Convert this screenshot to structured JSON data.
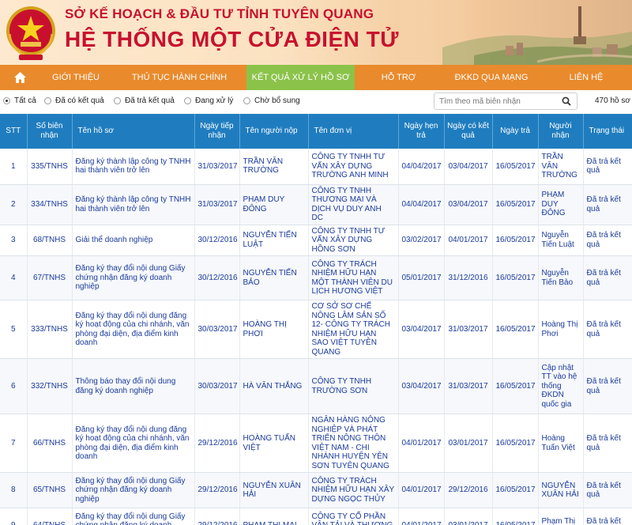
{
  "header": {
    "org_name": "SỞ KẾ HOẠCH & ĐẦU TƯ TỈNH TUYÊN QUANG",
    "system_name": "HỆ THỐNG MỘT CỬA ĐIỆN TỬ"
  },
  "nav": {
    "home_icon": "home-icon",
    "items": [
      "GIỚI THIỆU",
      "THỦ TỤC HÀNH CHÍNH",
      "KẾT QUẢ XỬ LÝ HỒ SƠ",
      "HỖ TRỢ",
      "ĐKKD QUA MẠNG",
      "LIÊN HỆ"
    ],
    "active_index": 2,
    "bar_color": "#e98a2c",
    "active_color": "#8bc34a"
  },
  "filters": {
    "options": [
      "Tất cả",
      "Đã có kết quả",
      "Đã trả kết quả",
      "Đang xử lý",
      "Chờ bổ sung"
    ],
    "selected_index": 0,
    "search_placeholder": "Tìm theo mã biên nhận",
    "search_icon": "search-icon",
    "total_text": "470 hồ sơ"
  },
  "table": {
    "headers": [
      "STT",
      "Số biên nhận",
      "Tên hồ sơ",
      "Ngày tiếp nhận",
      "Tên người nộp",
      "Tên đơn vị",
      "Ngày hẹn trả",
      "Ngày có kết quả",
      "Ngày trả",
      "Người nhận",
      "Trạng thái"
    ],
    "header_color": "#1f7dbf",
    "rows": [
      {
        "stt": "1",
        "so": "335/TNHS",
        "ten": "Đăng ký thành lập công ty TNHH hai thành viên trở lên",
        "ngay_tn": "31/03/2017",
        "nguoi_nop": "TRẦN VĂN TRƯỜNG",
        "don_vi": "CÔNG TY TNHH TƯ VẤN XÂY DỰNG TRƯỜNG ANH MINH",
        "hen_tra": "04/04/2017",
        "co_kq": "03/04/2017",
        "ngay_tra": "16/05/2017",
        "nguoi_nhan": "TRẦN VĂN TRƯỜNG",
        "trang_thai": "Đã trả kết quả"
      },
      {
        "stt": "2",
        "so": "334/TNHS",
        "ten": "Đăng ký thành lập công ty TNHH hai thành viên trở lên",
        "ngay_tn": "31/03/2017",
        "nguoi_nop": "PHẠM DUY ĐÔNG",
        "don_vi": "CÔNG TY TNHH THƯƠNG MẠI VÀ DỊCH VỤ DUY ANH DC",
        "hen_tra": "04/04/2017",
        "co_kq": "03/04/2017",
        "ngay_tra": "16/05/2017",
        "nguoi_nhan": "PHẠM DUY ĐÔNG",
        "trang_thai": "Đã trả kết quả"
      },
      {
        "stt": "3",
        "so": "68/TNHS",
        "ten": "Giải thể doanh nghiệp",
        "ngay_tn": "30/12/2016",
        "nguoi_nop": "NGUYỄN TIẾN LUẬT",
        "don_vi": "CÔNG TY TNHH TƯ VẤN XÂY DỰNG HỒNG SƠN",
        "hen_tra": "03/02/2017",
        "co_kq": "04/01/2017",
        "ngay_tra": "16/05/2017",
        "nguoi_nhan": "Nguyễn Tiến Luật",
        "trang_thai": "Đã trả kết quả"
      },
      {
        "stt": "4",
        "so": "67/TNHS",
        "ten": "Đăng ký thay đổi nội dung Giấy chứng nhận đăng ký doanh nghiệp",
        "ngay_tn": "30/12/2016",
        "nguoi_nop": "NGUYỄN TIẾN BẢO",
        "don_vi": "CÔNG TY TRÁCH NHIỆM HỮU HẠN MỘT THÀNH VIÊN DU LỊCH HƯƠNG VIỆT",
        "hen_tra": "05/01/2017",
        "co_kq": "31/12/2016",
        "ngay_tra": "16/05/2017",
        "nguoi_nhan": "Nguyễn Tiến Bảo",
        "trang_thai": "Đã trả kết quả"
      },
      {
        "stt": "5",
        "so": "333/TNHS",
        "ten": "Đăng ký thay đổi nội dung đăng ký hoạt động của chi nhánh, văn phòng đại diện, địa điểm kinh doanh",
        "ngay_tn": "30/03/2017",
        "nguoi_nop": "HOÀNG THỊ PHƠI",
        "don_vi": "CƠ SỞ SƠ CHẾ NÔNG LÂM SẢN SỐ 12- CÔNG TY TRÁCH NHIỆM HỮU HẠN SAO VIỆT TUYÊN QUANG",
        "hen_tra": "03/04/2017",
        "co_kq": "31/03/2017",
        "ngay_tra": "16/05/2017",
        "nguoi_nhan": "Hoàng Thị Phơi",
        "trang_thai": "Đã trả kết quả"
      },
      {
        "stt": "6",
        "so": "332/TNHS",
        "ten": "Thông báo thay đổi nội dung đăng ký doanh nghiệp",
        "ngay_tn": "30/03/2017",
        "nguoi_nop": "HÀ VĂN THẮNG",
        "don_vi": "CÔNG TY TNHH TRƯỜNG SƠN",
        "hen_tra": "03/04/2017",
        "co_kq": "31/03/2017",
        "ngay_tra": "16/05/2017",
        "nguoi_nhan": "Cập nhật TT vào hệ thống ĐKDN quốc gia",
        "trang_thai": "Đã trả kết quả"
      },
      {
        "stt": "7",
        "so": "66/TNHS",
        "ten": "Đăng ký thay đổi nội dung đăng ký hoạt động của chi nhánh, văn phòng đại diện, địa điểm kinh doanh",
        "ngay_tn": "29/12/2016",
        "nguoi_nop": "HOÀNG TUẤN VIỆT",
        "don_vi": "NGÂN HÀNG NÔNG NGHIỆP VÀ PHÁT TRIỂN NÔNG THÔN VIỆT NAM - CHI NHÁNH HUYỆN YÊN SƠN TUYÊN QUANG",
        "hen_tra": "04/01/2017",
        "co_kq": "03/01/2017",
        "ngay_tra": "16/05/2017",
        "nguoi_nhan": "Hoàng Tuấn Việt",
        "trang_thai": "Đã trả kết quả"
      },
      {
        "stt": "8",
        "so": "65/TNHS",
        "ten": "Đăng ký thay đổi nội dung Giấy chứng nhận đăng ký doanh nghiệp",
        "ngay_tn": "29/12/2016",
        "nguoi_nop": "NGUYỄN XUÂN HẢI",
        "don_vi": "CÔNG TY TRÁCH NHIỆM HỮU HẠN XÂY DỰNG NGỌC THỦY",
        "hen_tra": "04/01/2017",
        "co_kq": "29/12/2016",
        "ngay_tra": "16/05/2017",
        "nguoi_nhan": "NGUYỄN XUÂN HẢI",
        "trang_thai": "Đã trả kết quả"
      },
      {
        "stt": "9",
        "so": "64/TNHS",
        "ten": "Đăng ký thay đổi nội dung Giấy chứng nhận đăng ký doanh nghiệp",
        "ngay_tn": "29/12/2016",
        "nguoi_nop": "PHẠM THỊ MAI",
        "don_vi": "CÔNG TY CỔ PHẦN VẬN TẢI VÀ THƯƠNG MẠI HOÀNG DƯƠNG",
        "hen_tra": "04/01/2017",
        "co_kq": "03/01/2017",
        "ngay_tra": "16/05/2017",
        "nguoi_nhan": "Phạm Thị Mai",
        "trang_thai": "Đã trả kết quả"
      }
    ]
  }
}
